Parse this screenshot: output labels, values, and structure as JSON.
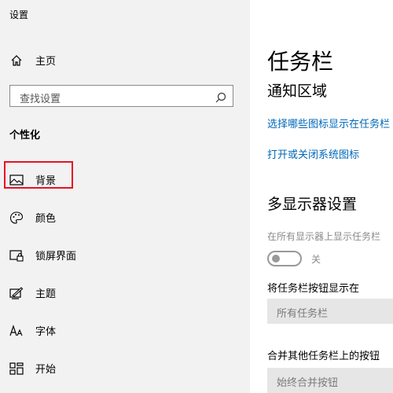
{
  "window": {
    "title": "设置"
  },
  "sidebar": {
    "home_label": "主页",
    "search_placeholder": "查找设置",
    "section_title": "个性化",
    "items": [
      {
        "label": "背景",
        "icon": "image-icon"
      },
      {
        "label": "颜色",
        "icon": "palette-icon"
      },
      {
        "label": "锁屏界面",
        "icon": "lock-screen-icon"
      },
      {
        "label": "主题",
        "icon": "theme-icon"
      },
      {
        "label": "字体",
        "icon": "font-icon"
      },
      {
        "label": "开始",
        "icon": "start-icon"
      }
    ]
  },
  "main": {
    "page_title": "任务栏",
    "notification_area": {
      "heading": "通知区域",
      "link1": "选择哪些图标显示在任务栏",
      "link2": "打开或关闭系统图标"
    },
    "multi_display": {
      "heading": "多显示器设置",
      "show_on_all_label": "在所有显示器上显示任务栏",
      "toggle_state": "关",
      "show_buttons_label": "将任务栏按钮显示在",
      "show_buttons_value": "所有任务栏",
      "combine_label": "合并其他任务栏上的按钮",
      "combine_value": "始终合并按钮"
    }
  },
  "colors": {
    "accent": "#0067b8",
    "highlight": "#e81123",
    "sidebar_bg": "#f2f2f2"
  }
}
